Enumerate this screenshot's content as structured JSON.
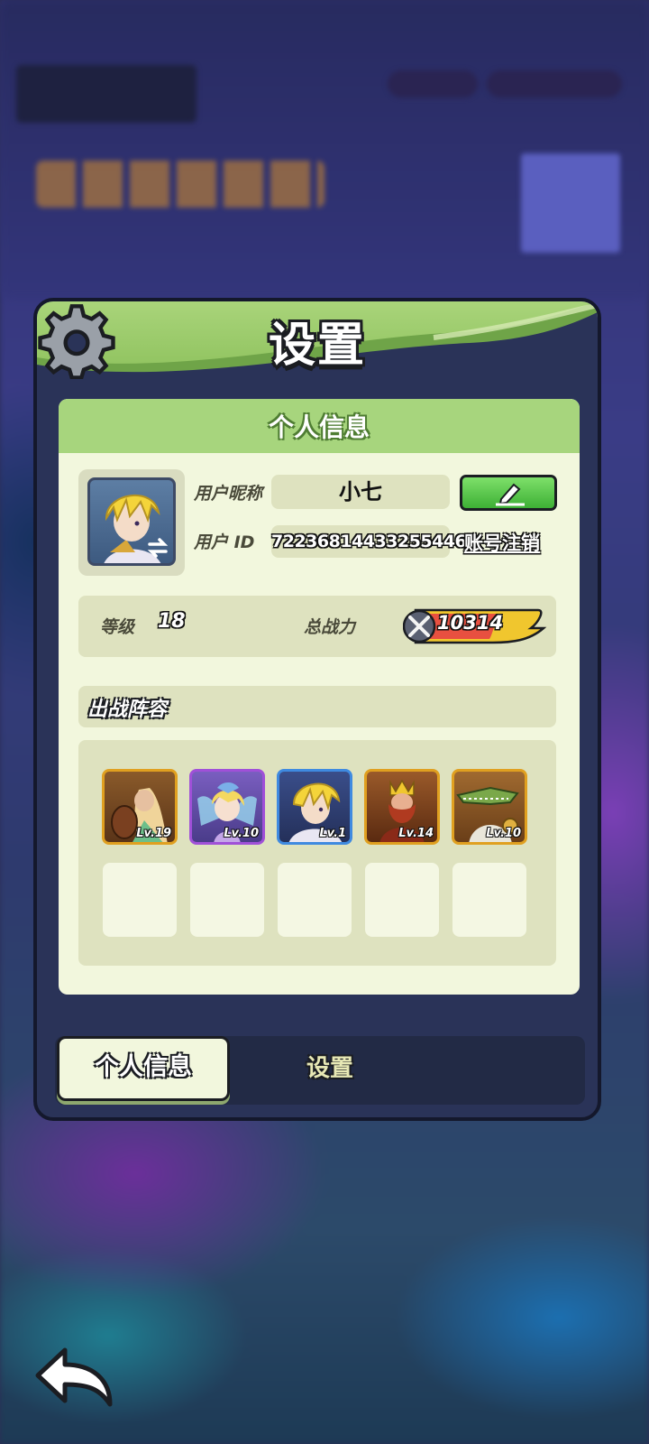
{
  "title": "设置",
  "profile_section": {
    "header": "个人信息",
    "nickname_label": "用户昵称",
    "nickname": "小七",
    "id_label": "用户 ID",
    "user_id": "72236814433255446",
    "cancel_account_label": "账号注销"
  },
  "stats": {
    "level_label": "等级",
    "level": "18",
    "power_label": "总战力",
    "power": "10314"
  },
  "lineup": {
    "title": "出战阵容",
    "heroes": [
      {
        "level": "Lv.19",
        "border": "#e0a020"
      },
      {
        "level": "Lv.10",
        "border": "#a050d8"
      },
      {
        "level": "Lv.1",
        "border": "#3f8ae0"
      },
      {
        "level": "Lv.14",
        "border": "#e0a020"
      },
      {
        "level": "Lv.10",
        "border": "#e0a020"
      }
    ],
    "empty_slots": 5
  },
  "tabs": {
    "profile": "个人信息",
    "settings": "设置"
  },
  "colors": {
    "accent_green": "#8dc15c",
    "panel_bg": "#2a3358",
    "card_bg": "#f2f7dd"
  }
}
